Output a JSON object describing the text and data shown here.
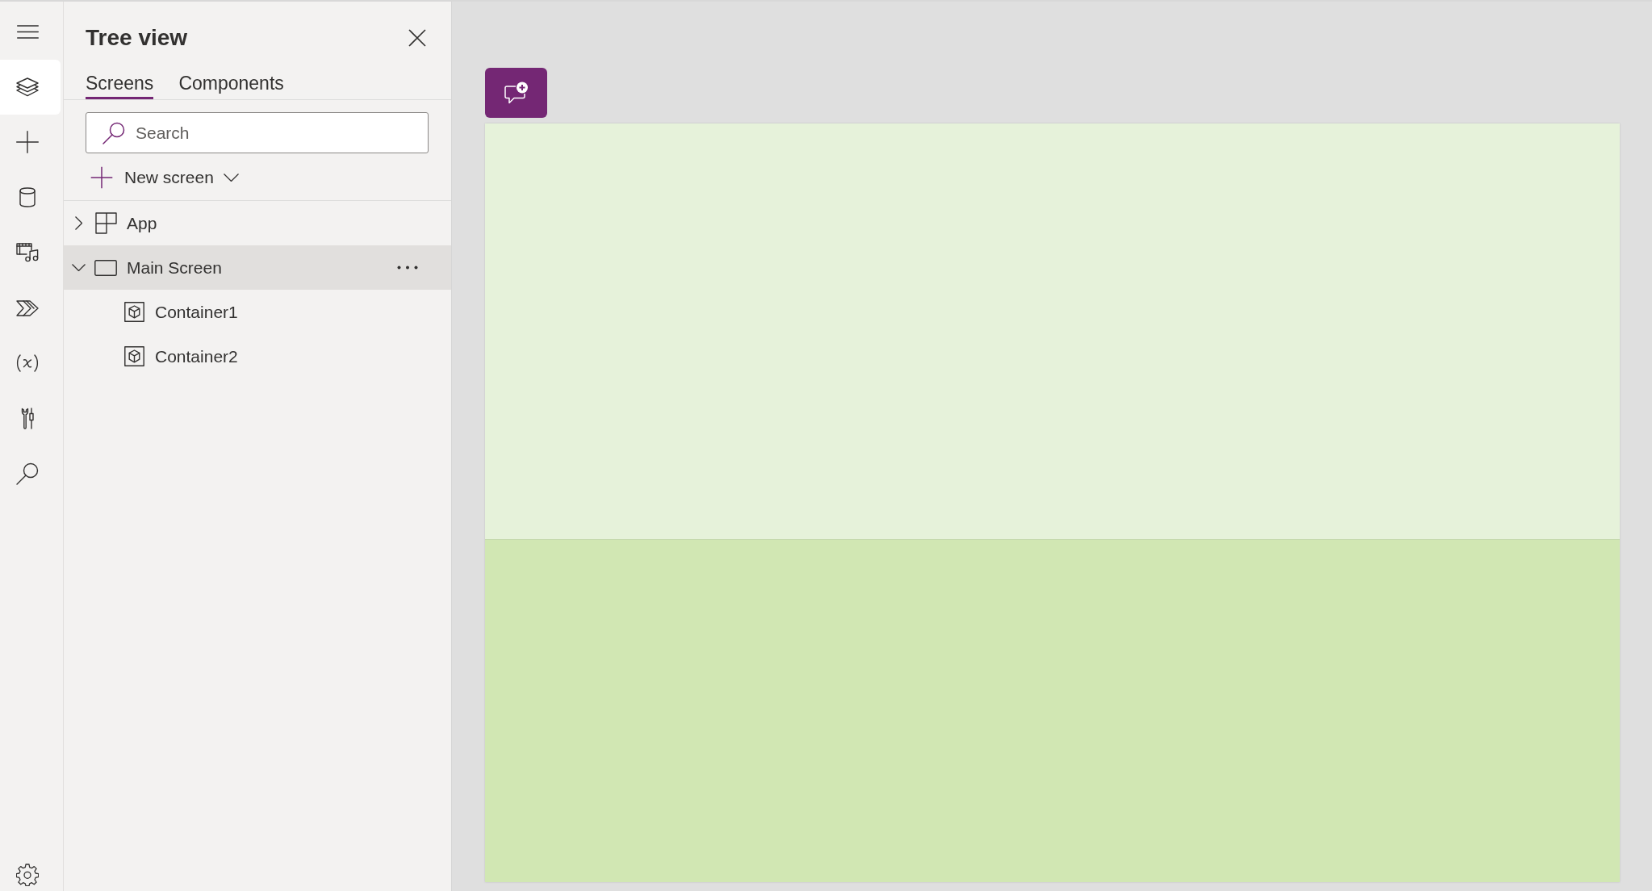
{
  "nav_rail": {
    "items": [
      {
        "selected": false
      },
      {
        "selected": true
      },
      {
        "selected": false
      },
      {
        "selected": false
      },
      {
        "selected": false
      },
      {
        "selected": false
      },
      {
        "selected": false
      },
      {
        "selected": false
      },
      {
        "selected": false
      }
    ]
  },
  "tree_view": {
    "title": "Tree view",
    "tabs": [
      {
        "label": "Screens",
        "selected": true
      },
      {
        "label": "Components",
        "selected": false
      }
    ],
    "search": {
      "placeholder": "Search"
    },
    "new_screen_button": {
      "label": "New screen"
    },
    "items": [
      {
        "label": "App",
        "kind": "app",
        "expanded": false,
        "selected": false
      },
      {
        "label": "Main Screen",
        "kind": "screen",
        "expanded": true,
        "selected": true,
        "children": [
          {
            "label": "Container1",
            "kind": "container",
            "selected": false
          },
          {
            "label": "Container2",
            "kind": "container",
            "selected": false
          }
        ]
      }
    ]
  },
  "canvas": {
    "containers": [
      {
        "color": "#e6f2da"
      },
      {
        "color": "#d1e7b3"
      }
    ]
  }
}
